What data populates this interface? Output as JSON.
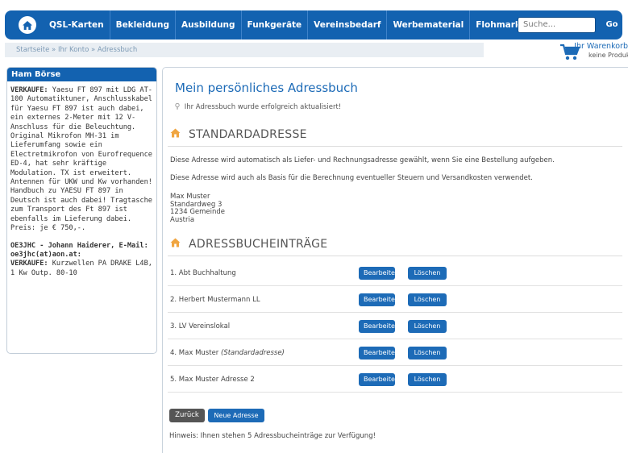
{
  "nav": {
    "items": [
      "QSL-Karten",
      "Bekleidung",
      "Ausbildung",
      "Funkgeräte",
      "Vereinsbedarf",
      "Werbematerial",
      "Flohmarkt"
    ],
    "search_placeholder": "Suche...",
    "go_label": "Go"
  },
  "breadcrumb": "Startseite » Ihr Konto » Adressbuch",
  "cart": {
    "title": "Ihr Warenkorb",
    "subtitle": "keine Produkte"
  },
  "sidebar": {
    "title": "Ham Börse",
    "ad1_keyword": "VERKAUFE:",
    "ad1_text": " Yaesu FT 897 mit LDG AT-100 Automatiktuner, Anschlusskabel für Yaesu FT 897 ist auch dabei, ein externes 2-Meter mit 12 V-Anschluss für die Beleuchtung. Original Mikrofon MH-31 im Lieferumfang sowie ein Electretmikrofon von Eurofrequence ED-4, hat sehr kräftige Modulation. TX ist erweitert. Antennen für UKW und Kw vorhanden! Handbuch zu YAESU FT 897 in Deutsch ist auch dabei! Tragtasche zum Transport des Ft 897 ist ebenfalls im Lieferung dabei.",
    "ad1_price": "Preis: je € 750,-.",
    "ad2_contact": "OE3JHC - Johann Haiderer, E-Mail: oe3jhc(at)aon.at:",
    "ad2_keyword": "VERKAUFE:",
    "ad2_text": " Kurzwellen PA DRAKE L4B, 1 Kw Outp. 80-10"
  },
  "main": {
    "title": "Mein persönliches Adressbuch",
    "success": "Ihr Adressbuch wurde erfolgreich aktualisiert!",
    "section_default": "STANDARDADRESSE",
    "info1": "Diese Adresse wird automatisch als Liefer- und Rechnungsadresse gewählt, wenn Sie eine Bestellung aufgeben.",
    "info2": "Diese Adresse wird auch als Basis für die Berechnung eventueller Steuern und Versandkosten verwendet.",
    "address": [
      "Max Muster",
      "Standardweg 3",
      "1234 Gemeinde",
      "Austria"
    ],
    "section_entries": "ADRESSBUCHEINTRÄGE",
    "entries": [
      {
        "label": "1. Abt Buchhaltung",
        "note": ""
      },
      {
        "label": "2. Herbert Mustermann LL",
        "note": ""
      },
      {
        "label": "3. LV Vereinslokal",
        "note": ""
      },
      {
        "label": "4. Max Muster",
        "note": "(Standardadresse)"
      },
      {
        "label": "5. Max Muster Adresse 2",
        "note": ""
      }
    ],
    "edit_label": "Bearbeiten",
    "delete_label": "Löschen",
    "back_label": "Zurück",
    "new_label": "Neue Adresse",
    "hint": "Hinweis: Ihnen stehen 5 Adressbucheinträge zur Verfügung!"
  },
  "colors": {
    "brand_blue": "#1362b0",
    "button_blue": "#1d6bb7",
    "dark_button": "#555555"
  }
}
